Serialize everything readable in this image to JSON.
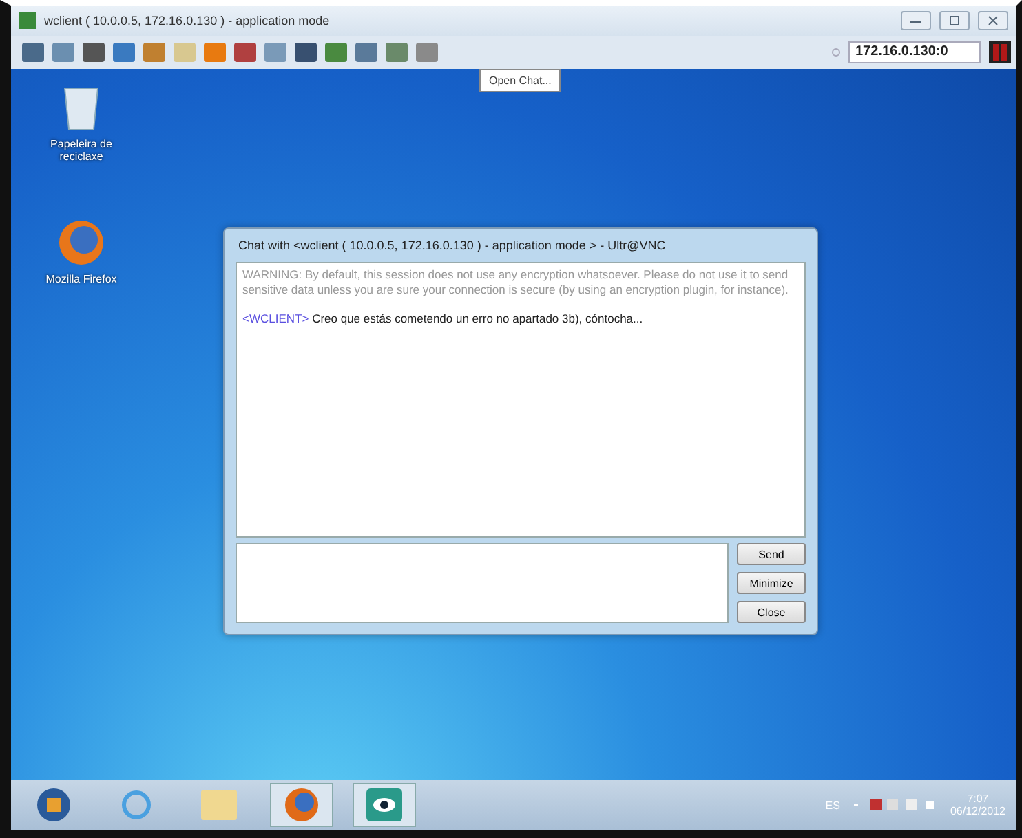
{
  "window": {
    "title": "wclient ( 10.0.0.5, 172.16.0.130 ) - application mode",
    "address": "172.16.0.130:0"
  },
  "toolbar": {
    "tooltip": "Open Chat..."
  },
  "desktop_icons": [
    {
      "label": "Papeleira de reciclaxe",
      "kind": "recycle"
    },
    {
      "label": "Mozilla Firefox",
      "kind": "firefox"
    }
  ],
  "chat": {
    "title": "Chat with <wclient ( 10.0.0.5, 172.16.0.130 ) - application mode > - Ultr@VNC",
    "warning": "WARNING: By default, this session does not use any encryption whatsoever. Please do not use it to send sensitive data unless you are sure your connection is secure (by using an encryption plugin, for instance).",
    "messages": [
      {
        "sender": "<WCLIENT>",
        "text": "Creo que estás cometendo un erro no apartado 3b), cóntocha..."
      }
    ],
    "buttons": [
      "Send",
      "Minimize",
      "Close"
    ]
  },
  "taskbar": {
    "language": "ES",
    "time": "7:07",
    "date": "06/12/2012"
  }
}
